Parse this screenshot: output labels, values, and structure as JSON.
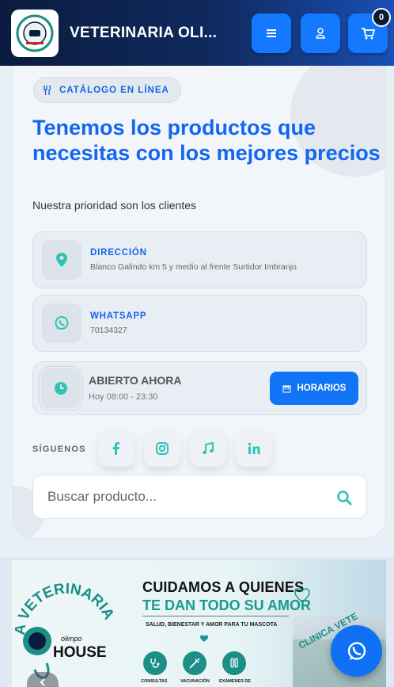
{
  "header": {
    "brand": "VETERINARIA OLI...",
    "cart_count": "0",
    "icons": {
      "menu": "bars-icon",
      "user": "user-icon",
      "cart": "cart-icon"
    }
  },
  "hero": {
    "badge": "CATÁLOGO EN LÍNEA",
    "title": "Tenemos los productos que necesitas con los mejores precios",
    "subtitle": "Nuestra prioridad son los clientes"
  },
  "info": {
    "address_label": "DIRECCIÓN",
    "address_value": "Blanco Galindo km 5 y medio al frente Surtidor Imbranjo",
    "whatsapp_label": "WHATSAPP",
    "whatsapp_value": "70134327"
  },
  "hours": {
    "status": "ABIERTO AHORA",
    "today": "Hoy 08:00 - 23:30",
    "button": "HORARIOS"
  },
  "social": {
    "label": "SÍGUENOS",
    "items": [
      "facebook-icon",
      "instagram-icon",
      "music-icon",
      "linkedin-icon"
    ]
  },
  "search": {
    "placeholder": "Buscar producto..."
  },
  "banner": {
    "arc_text": "A VETERINARIA",
    "brand_small": "olimpo",
    "brand_big": "HOUSE",
    "headline1": "CUIDAMOS A QUIENES",
    "headline2": "TE DAN TODO SU AMOR",
    "tagline": "SALUD, BIENESTAR Y AMOR PARA TU MASCOTA",
    "services": [
      "CONSULTAS",
      "VACUNACIÓN",
      "EXÁMENES DE"
    ],
    "sign_text": "CLINICA VETE"
  },
  "colors": {
    "primary": "#1366ef",
    "button": "#1173f5",
    "accent": "#2ec4b6",
    "header": "#0f2a5f"
  }
}
